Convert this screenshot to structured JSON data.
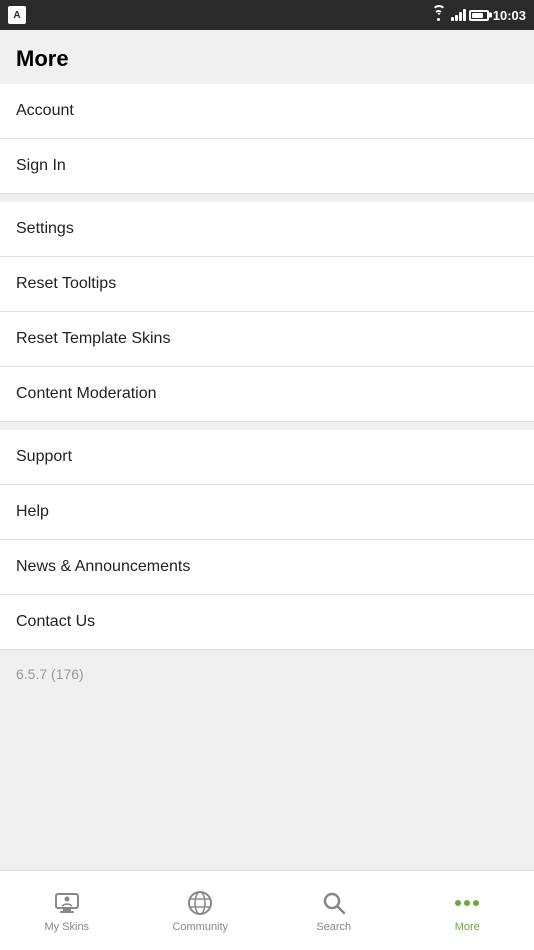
{
  "status_bar": {
    "time": "10:03",
    "app_icon_label": "A"
  },
  "page": {
    "title": "More"
  },
  "menu_sections": [
    {
      "id": "section1",
      "items": [
        {
          "id": "account",
          "label": "Account"
        },
        {
          "id": "sign-in",
          "label": "Sign In"
        }
      ]
    },
    {
      "id": "section2",
      "items": [
        {
          "id": "settings",
          "label": "Settings"
        },
        {
          "id": "reset-tooltips",
          "label": "Reset Tooltips"
        },
        {
          "id": "reset-template-skins",
          "label": "Reset Template Skins"
        },
        {
          "id": "content-moderation",
          "label": "Content Moderation"
        }
      ]
    },
    {
      "id": "section3",
      "items": [
        {
          "id": "support",
          "label": "Support"
        },
        {
          "id": "help",
          "label": "Help"
        },
        {
          "id": "news-announcements",
          "label": "News & Announcements"
        },
        {
          "id": "contact-us",
          "label": "Contact Us"
        }
      ]
    }
  ],
  "version": "6.5.7 (176)",
  "bottom_nav": {
    "items": [
      {
        "id": "my-skins",
        "label": "My Skins",
        "active": false
      },
      {
        "id": "community",
        "label": "Community",
        "active": false
      },
      {
        "id": "search",
        "label": "Search",
        "active": false
      },
      {
        "id": "more",
        "label": "More",
        "active": true
      }
    ]
  }
}
